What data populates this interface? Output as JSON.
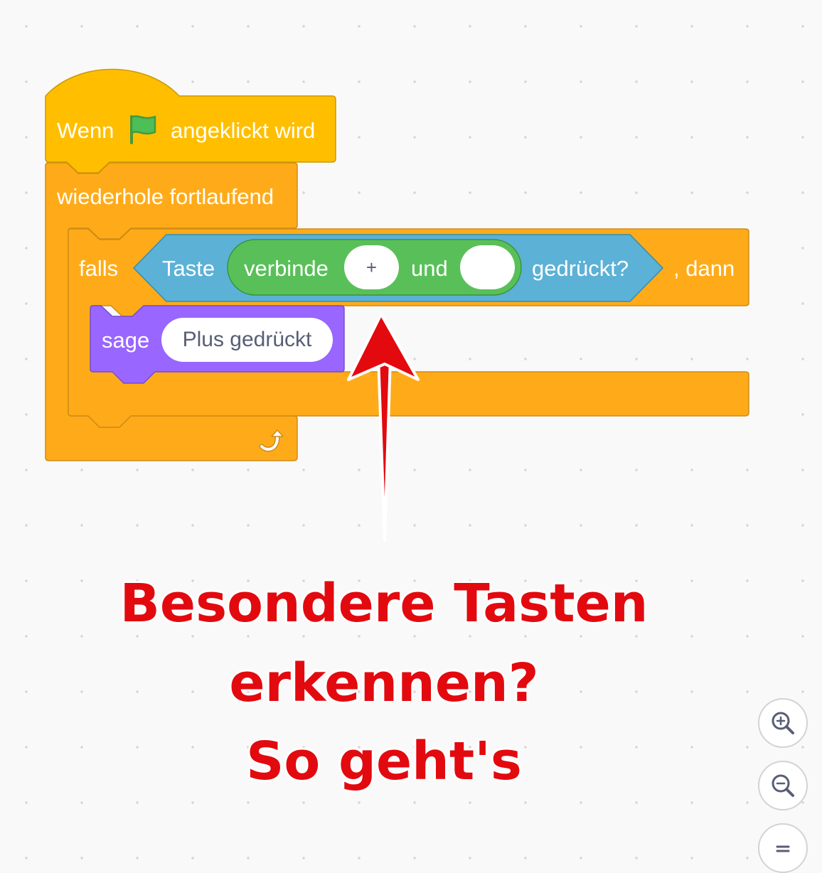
{
  "colors": {
    "event": "#ffbf00",
    "control": "#ffab19",
    "sensing": "#5cb1d6",
    "operators": "#59c059",
    "looks": "#9966ff",
    "annotation": "#e20a0f"
  },
  "hat_block": {
    "label_prefix": "Wenn",
    "icon": "green-flag-icon",
    "label_suffix": "angeklickt wird"
  },
  "forever_block": {
    "label": "wiederhole fortlaufend",
    "loop_icon": "loop-arrow-icon"
  },
  "if_block": {
    "label_if": "falls",
    "label_then": ", dann"
  },
  "sensing_block": {
    "label": "Taste",
    "suffix": "gedrückt?"
  },
  "join_block": {
    "label": "verbinde",
    "mid": "und",
    "input1": "+",
    "input2": ""
  },
  "say_block": {
    "label": "sage",
    "input": "Plus gedrückt"
  },
  "annotation": {
    "line1": "Besondere Tasten",
    "line2": "erkennen?",
    "line3": "So geht's"
  },
  "zoom_controls": {
    "zoom_in": "zoom-in-icon",
    "zoom_out": "zoom-out-icon",
    "reset": "zoom-reset-icon"
  }
}
